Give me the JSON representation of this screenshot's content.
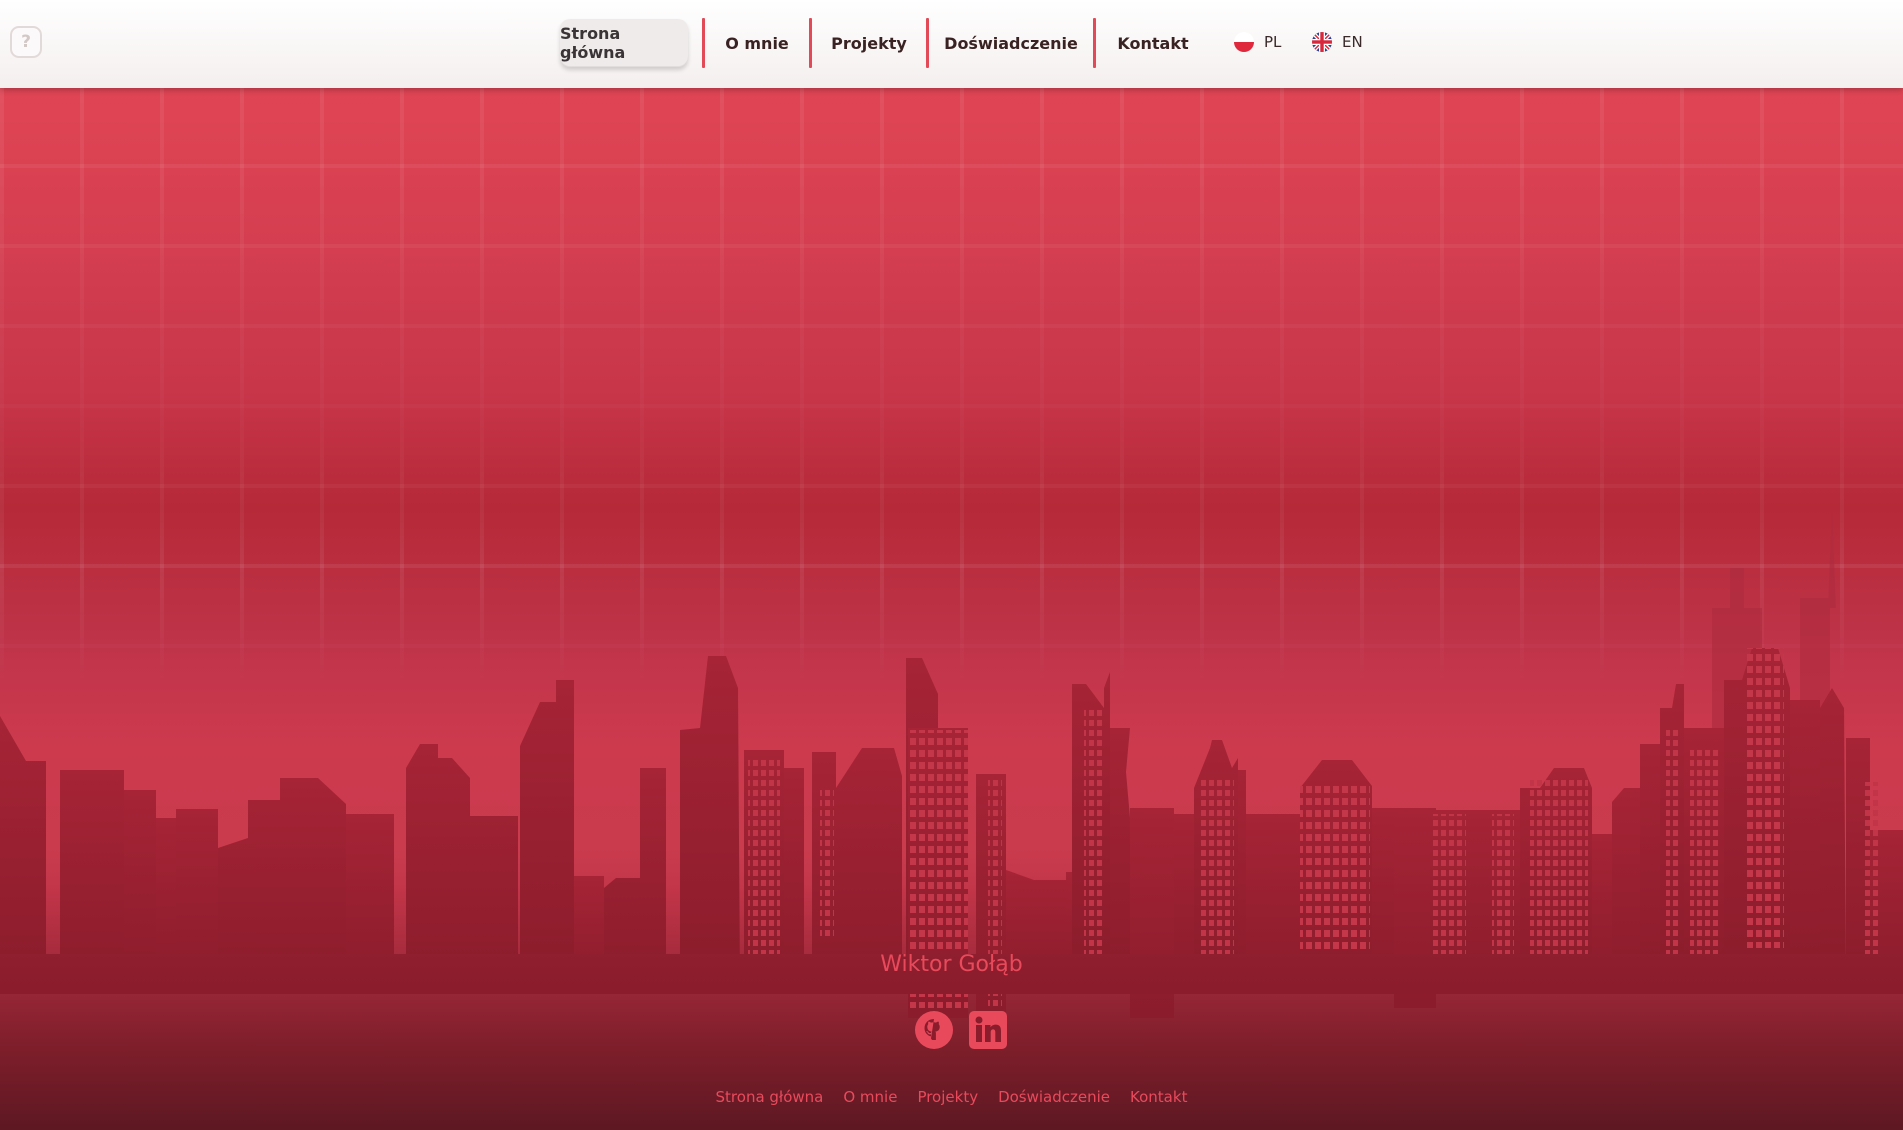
{
  "header": {
    "help_label": "?",
    "nav": [
      {
        "label": "Strona główna",
        "active": true
      },
      {
        "label": "O mnie"
      },
      {
        "label": "Projekty"
      },
      {
        "label": "Doświadczenie"
      },
      {
        "label": "Kontakt"
      }
    ],
    "languages": [
      {
        "code": "PL",
        "icon": "poland-flag-icon"
      },
      {
        "code": "EN",
        "icon": "uk-flag-icon"
      }
    ]
  },
  "hero": {
    "background_color": "#c8364a",
    "accent": "#e24a58"
  },
  "footer": {
    "name": "Wiktor Gołąb",
    "socials": [
      {
        "icon": "github-icon"
      },
      {
        "icon": "linkedin-icon"
      }
    ],
    "links": [
      "Strona główna",
      "O mnie",
      "Projekty",
      "Doświadczenie",
      "Kontakt"
    ],
    "text_color": "#e84a5c"
  }
}
